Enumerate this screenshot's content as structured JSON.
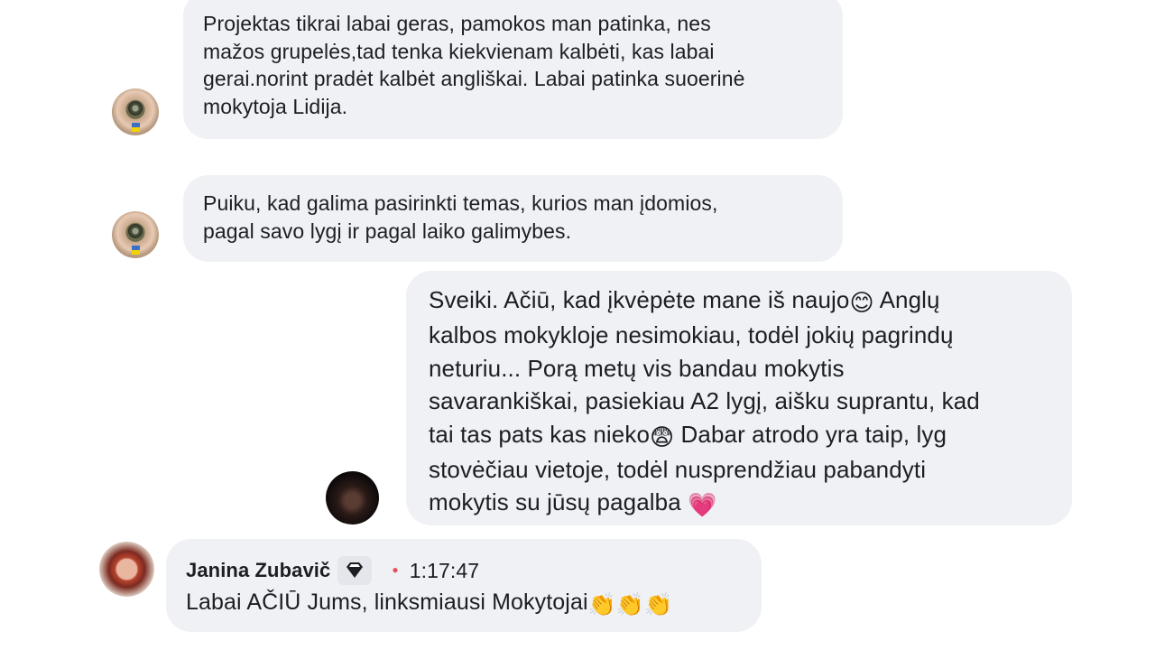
{
  "messages": [
    {
      "text": "Projektas tikrai labai geras, pamokos man  patinka, nes\nmažos grupelės,tad tenka kiekvienam kalbėti, kas labai\ngerai.norint pradėt kalbėt angliškai. Labai patinka suoerinė\nmokytoja Lidija."
    },
    {
      "text": "Puiku, kad galima pasirinkti temas, kurios man įdomios,\npagal savo lygį ir pagal laiko galimybes."
    },
    {
      "text_part1": "Sveiki. Ačiū, kad įkvėpėte mane iš naujo",
      "emoji1": "😊",
      "text_part2": " Anglų\nkalbos mokykloje nesimokiau, todėl jokių pagrindų\nneturiu... Porą metų vis bandau mokytis\nsavarankiškai, pasiekiau A2 lygį, aišku suprantu, kad\ntai tas pats kas nieko",
      "emoji2": "😨",
      "text_part3": " Dabar atrodo yra taip, lyg\nstovėčiau vietoje, todėl nusprendžiau pabandyti\nmokytis su jūsų pagalba ",
      "emoji3": "💗"
    },
    {
      "author": "Janina Zubavič",
      "badge_icon": "diamond-icon",
      "timestamp": "1:17:47",
      "text": "Labai AČIŪ Jums, linksmiausi Mokytojai",
      "emoji": "👏👏👏"
    }
  ],
  "colors": {
    "bubble": "#f0f1f4",
    "text": "#1c1e21",
    "dot": "#e4505a",
    "badge": "#e4e6eb"
  }
}
